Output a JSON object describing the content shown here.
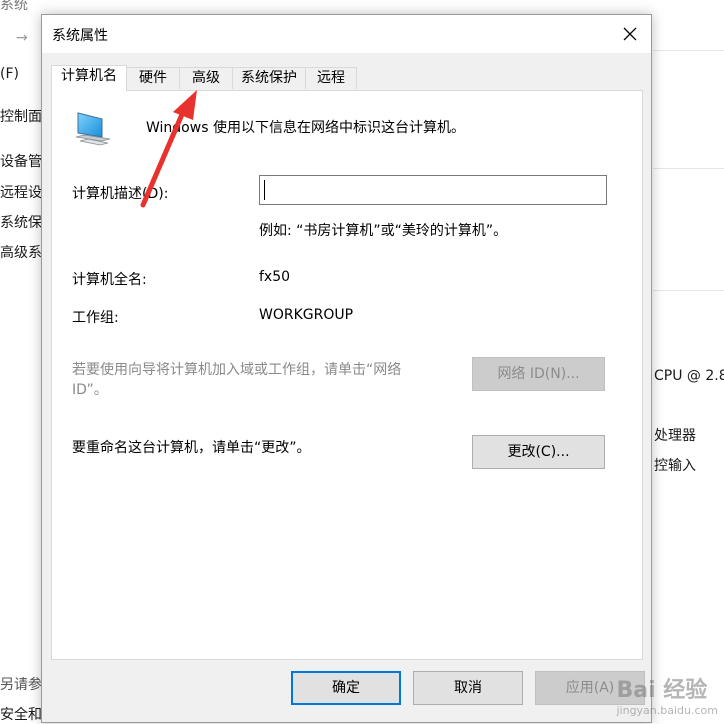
{
  "background": {
    "left_items": [
      "系统",
      "(F)",
      "控制面",
      "设备管",
      "远程设",
      "系统保",
      "高级系",
      "另请参",
      "安全和维"
    ],
    "right_items": [
      "CPU @ 2.8",
      "处理器",
      "控输入"
    ]
  },
  "dialog": {
    "title": "系统属性",
    "tabs": [
      "计算机名",
      "硬件",
      "高级",
      "系统保护",
      "远程"
    ],
    "header_text": "Windows 使用以下信息在网络中标识这台计算机。",
    "description_label": "计算机描述(D):",
    "description_value": "",
    "example_text": "例如: “书房计算机”或“美玲的计算机”。",
    "full_name_label": "计算机全名:",
    "full_name_value": "fx50",
    "workgroup_label": "工作组:",
    "workgroup_value": "WORKGROUP",
    "network_hint": "若要使用向导将计算机加入域或工作组，请单击“网络ID”。",
    "network_hint_line1": "若要使用向导将计算机加入域或工作组，请单击“网络",
    "network_hint_line2": "ID”。",
    "network_button": "网络 ID(N)...",
    "rename_text": "要重命名这台计算机，请单击“更改”。",
    "change_button": "更改(C)...",
    "ok_button": "确定",
    "cancel_button": "取消",
    "apply_button": "应用(A)"
  },
  "watermark": {
    "brand": "Bai 经验",
    "url": "jingyan.baidu.com"
  },
  "colors": {
    "accent": "#0078d7",
    "annotation_arrow": "#e8322e"
  }
}
